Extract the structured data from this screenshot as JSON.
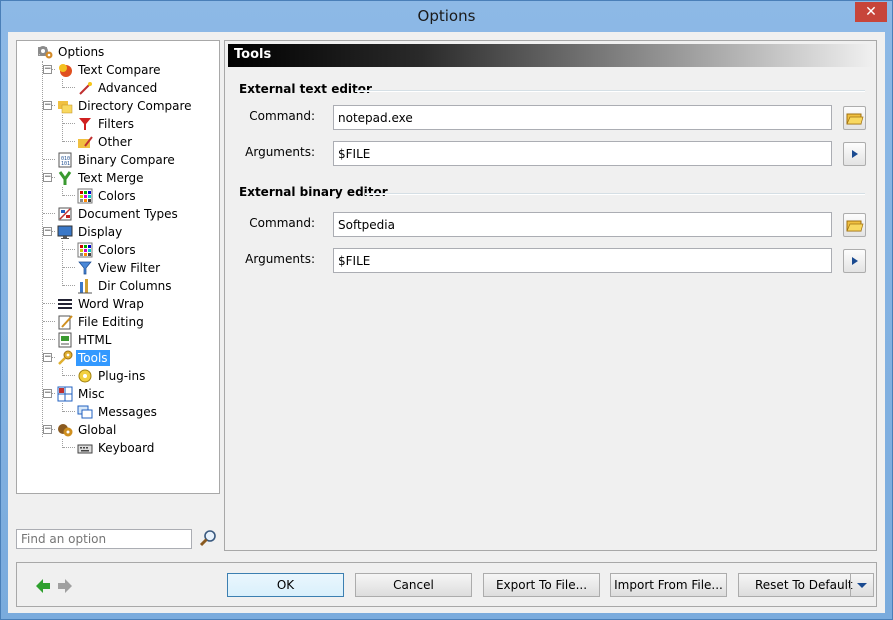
{
  "window": {
    "title": "Options",
    "close_glyph": "✕"
  },
  "tree": {
    "items": [
      {
        "label": "Options",
        "icon": "gears-icon"
      },
      {
        "label": "Text Compare",
        "icon": "text-compare-icon"
      },
      {
        "label": "Advanced",
        "icon": "wand-icon"
      },
      {
        "label": "Directory Compare",
        "icon": "folders-icon"
      },
      {
        "label": "Filters",
        "icon": "filter-icon"
      },
      {
        "label": "Other",
        "icon": "folder-pencil-icon"
      },
      {
        "label": "Binary Compare",
        "icon": "binary-icon"
      },
      {
        "label": "Text Merge",
        "icon": "merge-icon"
      },
      {
        "label": "Colors",
        "icon": "palette-icon"
      },
      {
        "label": "Document Types",
        "icon": "document-types-icon"
      },
      {
        "label": "Display",
        "icon": "monitor-icon"
      },
      {
        "label": "Colors",
        "icon": "palette-icon"
      },
      {
        "label": "View Filter",
        "icon": "funnel-icon"
      },
      {
        "label": "Dir Columns",
        "icon": "columns-icon"
      },
      {
        "label": "Word Wrap",
        "icon": "word-wrap-icon"
      },
      {
        "label": "File Editing",
        "icon": "edit-file-icon"
      },
      {
        "label": "HTML",
        "icon": "html-icon"
      },
      {
        "label": "Tools",
        "icon": "key-icon"
      },
      {
        "label": "Plug-ins",
        "icon": "plugin-icon"
      },
      {
        "label": "Misc",
        "icon": "misc-icon"
      },
      {
        "label": "Messages",
        "icon": "messages-icon"
      },
      {
        "label": "Global",
        "icon": "global-icon"
      },
      {
        "label": "Keyboard",
        "icon": "keyboard-icon"
      }
    ],
    "selected": "Tools"
  },
  "search": {
    "placeholder": "Find an option"
  },
  "panel": {
    "header": "Tools",
    "text_editor": {
      "title": "External text editor",
      "command_label": "Command:",
      "command_value": "notepad.exe",
      "arguments_label": "Arguments:",
      "arguments_value": "$FILE"
    },
    "binary_editor": {
      "title": "External binary editor",
      "command_label": "Command:",
      "command_value": "Softpedia",
      "arguments_label": "Arguments:",
      "arguments_value": "$FILE"
    }
  },
  "buttons": {
    "ok": "OK",
    "cancel": "Cancel",
    "export": "Export To File...",
    "import": "Import From File...",
    "reset": "Reset To Default"
  },
  "colors": {
    "selection": "#3399ff",
    "back_arrow": "#2ea02e",
    "forward_arrow": "#a0a0a0"
  }
}
